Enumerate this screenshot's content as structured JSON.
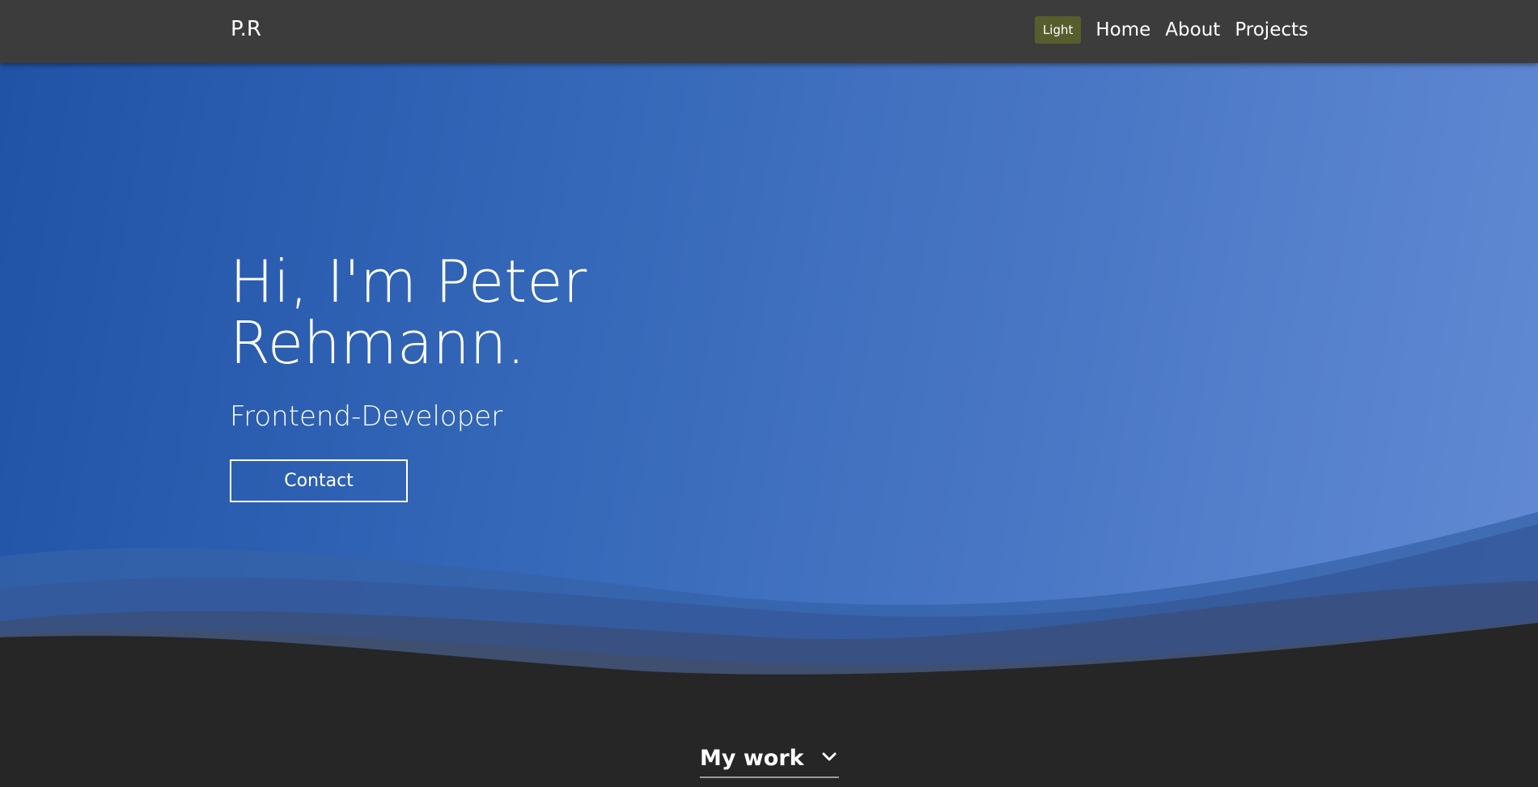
{
  "nav": {
    "brand": "P.R",
    "theme_toggle": "Light",
    "links": [
      "Home",
      "About",
      "Projects"
    ]
  },
  "hero": {
    "title_line1": "Hi, I'm Peter",
    "title_line2": "Rehmann.",
    "subtitle": "Frontend-Developer",
    "contact_button": "Contact"
  },
  "work": {
    "label": "My work"
  },
  "colors": {
    "navbar": "#3c3c3c",
    "hero_gradient_start": "#2052a6",
    "hero_gradient_end": "#628ad4",
    "page_background": "#262626",
    "theme_toggle": "#585d2e"
  }
}
